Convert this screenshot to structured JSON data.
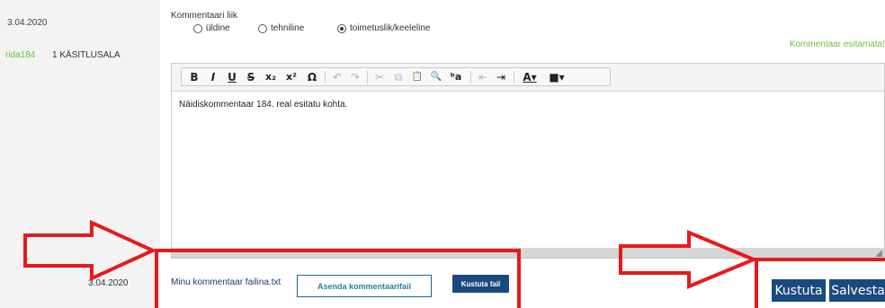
{
  "sidebar": {
    "date_top": "3.04.2020",
    "row_link": "rida184",
    "row_section": "1 KÄSITLUSALA",
    "date_bottom": "3.04.2020"
  },
  "comment_type": {
    "label": "Kommentaari liik",
    "options": [
      {
        "label": "üldine",
        "selected": false
      },
      {
        "label": "tehniline",
        "selected": false
      },
      {
        "label": "toimetuslik/keeleline",
        "selected": true
      }
    ]
  },
  "notice": "Kommentaar esitamata!",
  "editor": {
    "toolbar": {
      "bold": "B",
      "italic": "I",
      "underline": "U",
      "strike": "S",
      "subscript": "x₂",
      "superscript": "x²",
      "special_char": "Ω",
      "undo": "↶",
      "redo": "↷",
      "cut": "✂",
      "copy": "⧉",
      "paste": "📋",
      "find": "🔍",
      "replace": "ᵇa",
      "outdent": "⇤",
      "indent": "⇥",
      "text_color": "A▾",
      "bg_color": "■▾"
    },
    "content": "Näidiskommentaar 184. real esitatu kohta."
  },
  "attachment": {
    "file_name": "Minu kommentaar failina.txt",
    "replace_label": "Asenda kommentaarifail",
    "delete_file_label": "Kustuta fail"
  },
  "actions": {
    "delete_label": "Kustuta",
    "save_label": "Salvesta"
  },
  "colors": {
    "accent_green": "#6bbf3a",
    "button_blue": "#1a4a7d",
    "annotation_red": "#e8191b"
  }
}
